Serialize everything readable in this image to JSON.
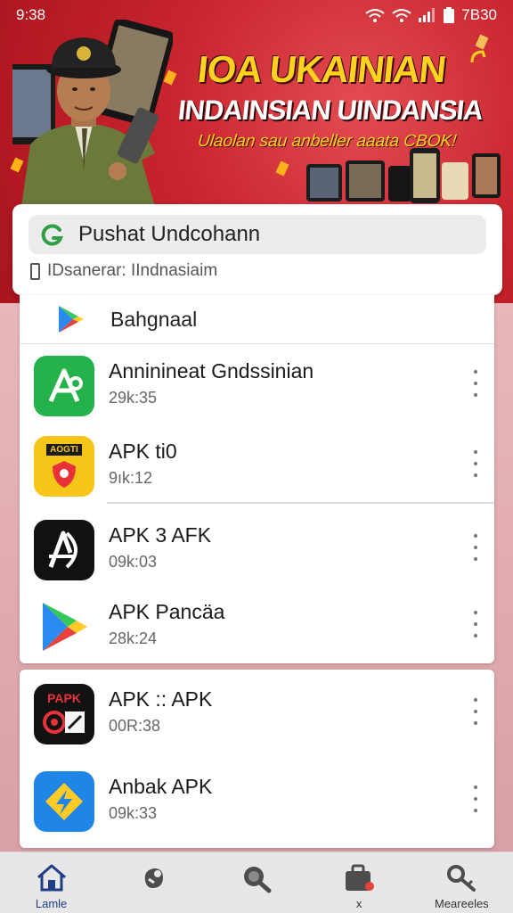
{
  "status_bar": {
    "time": "9:38",
    "battery_text": "7B30"
  },
  "banner": {
    "title_line1": "IOA UKAINIAN",
    "title_line2": "INDAINSIAN UINDANSIA",
    "tagline": "Ulaolan sau anbeller aaata CBOK!"
  },
  "search": {
    "value": "Pushat Undcohann",
    "subtitle": "IDsanerar: IIndnasiaim"
  },
  "section": {
    "label": "Bahgnaal"
  },
  "apps_card_a": [
    {
      "name": "Anninineat Gndssinian",
      "meta": "29k:35",
      "icon": "green-a-icon"
    },
    {
      "name": "APK ti0",
      "meta": "9ık:12",
      "icon": "yellow-shield-icon"
    },
    {
      "name": "APK 3 AFK",
      "meta": "09k:03",
      "icon": "black-a-icon"
    },
    {
      "name": "APK Pancäa",
      "meta": "28k:24",
      "icon": "play-arrow-icon"
    }
  ],
  "apps_card_b": [
    {
      "name": "APK :: APK",
      "meta": "00R:38",
      "icon": "papk-icon"
    },
    {
      "name": "Anbak APK",
      "meta": "09k:33",
      "icon": "blue-bolt-icon"
    }
  ],
  "yellow_badge_text": "AOGTI",
  "papk_badge_text": "PAPK",
  "bottom_nav": [
    {
      "label": "Lamle",
      "icon": "home-icon",
      "active": true
    },
    {
      "label": "",
      "icon": "apps-icon",
      "active": false
    },
    {
      "label": "",
      "icon": "search-icon",
      "active": false
    },
    {
      "label": "x",
      "icon": "briefcase-icon",
      "active": false
    },
    {
      "label": "Meareeles",
      "icon": "key-icon",
      "active": false
    }
  ],
  "colors": {
    "banner_red": "#c9252e",
    "title_yellow": "#ffd21f",
    "nav_active": "#1e3f85"
  }
}
